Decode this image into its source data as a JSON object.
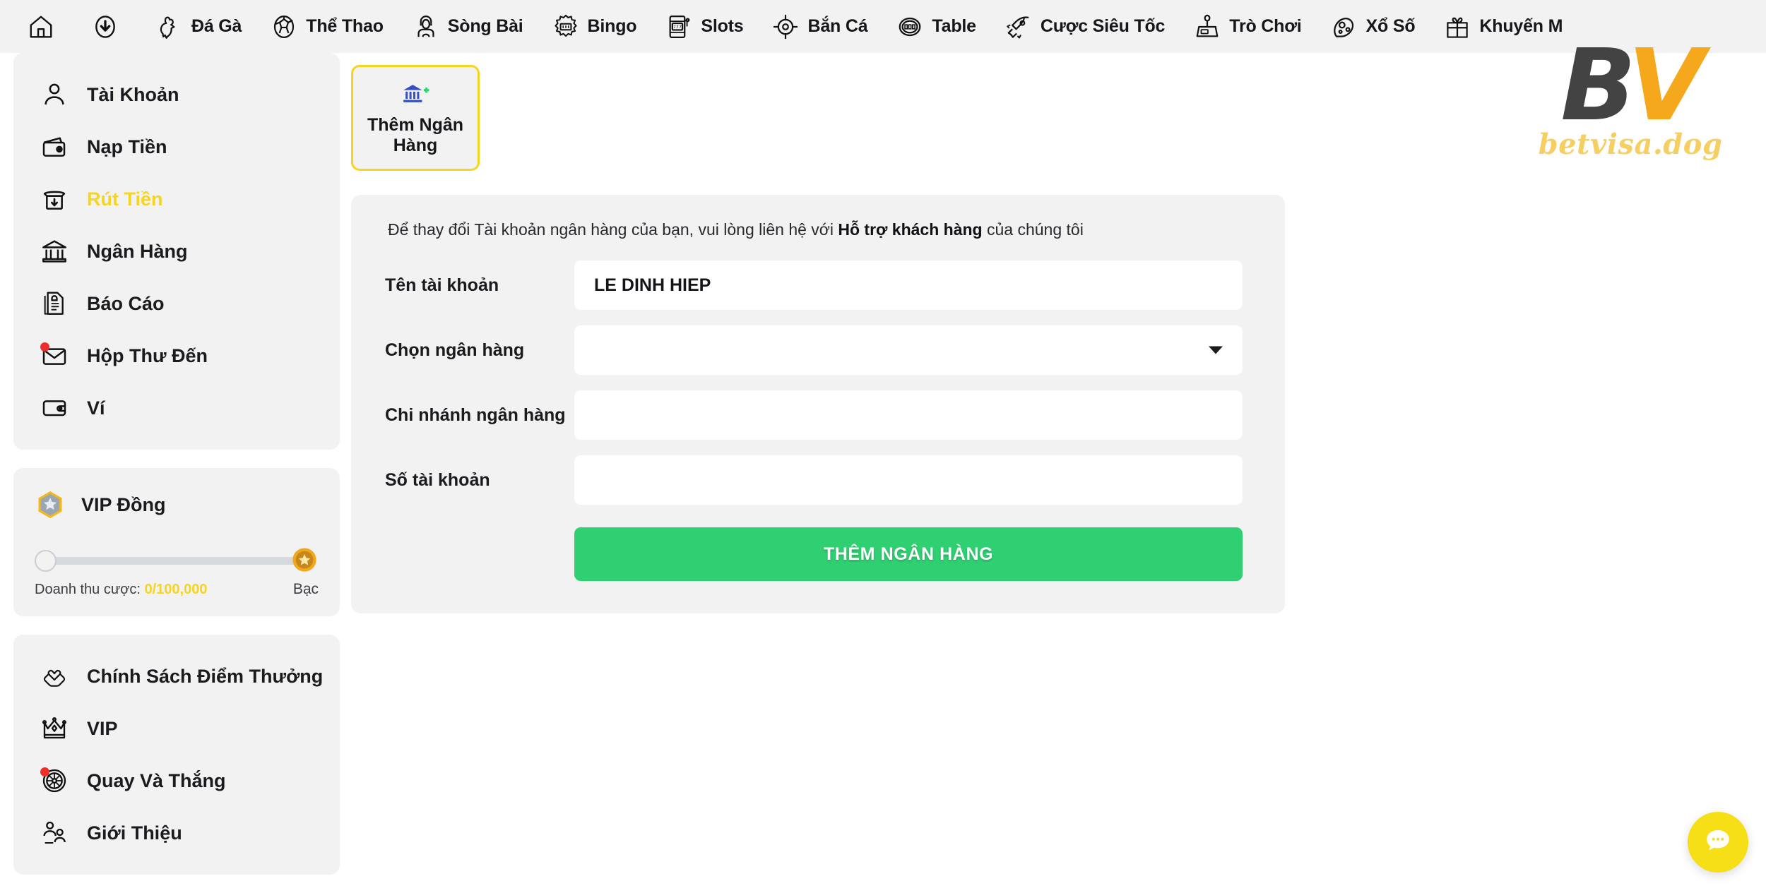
{
  "topnav": {
    "items": [
      {
        "label": "",
        "icon": "home-icon"
      },
      {
        "label": "",
        "icon": "download-icon"
      },
      {
        "label": "Đá Gà",
        "icon": "rooster-icon"
      },
      {
        "label": "Thể Thao",
        "icon": "soccer-ball-icon"
      },
      {
        "label": "Sòng Bài",
        "icon": "casino-dealer-icon"
      },
      {
        "label": "Bingo",
        "icon": "bingo-icon"
      },
      {
        "label": "Slots",
        "icon": "slot-machine-icon"
      },
      {
        "label": "Bắn Cá",
        "icon": "target-icon"
      },
      {
        "label": "Table",
        "icon": "table-games-icon"
      },
      {
        "label": "Cược Siêu Tốc",
        "icon": "rocket-icon"
      },
      {
        "label": "Trò Chơi",
        "icon": "arcade-icon"
      },
      {
        "label": "Xổ Số",
        "icon": "lottery-ball-icon"
      },
      {
        "label": "Khuyến M",
        "icon": "gift-icon"
      }
    ]
  },
  "sidebar": {
    "menu": [
      {
        "label": "Tài Khoản",
        "icon": "user-icon",
        "active": false,
        "badge": false
      },
      {
        "label": "Nạp Tiền",
        "icon": "wallet-deposit-icon",
        "active": false,
        "badge": false
      },
      {
        "label": "Rút Tiền",
        "icon": "withdraw-icon",
        "active": true,
        "badge": false
      },
      {
        "label": "Ngân Hàng",
        "icon": "bank-icon",
        "active": false,
        "badge": false
      },
      {
        "label": "Báo Cáo",
        "icon": "report-icon",
        "active": false,
        "badge": false
      },
      {
        "label": "Hộp Thư Đến",
        "icon": "envelope-icon",
        "active": false,
        "badge": true
      },
      {
        "label": "Ví",
        "icon": "wallet-icon",
        "active": false,
        "badge": false
      }
    ],
    "vip": {
      "title": "VIP Đồng",
      "badge_icon": "vip-hex-star-icon",
      "end_badge_icon": "silver-tier-badge-icon",
      "revenue_label": "Doanh thu cược:",
      "revenue_value": "0/100,000",
      "tier_label": "Bạc",
      "progress_percent": 0
    },
    "promo_menu": [
      {
        "label": "Chính Sách Điểm Thưởng",
        "icon": "hands-heart-icon",
        "badge": false
      },
      {
        "label": "VIP",
        "icon": "crown-icon",
        "badge": false
      },
      {
        "label": "Quay Và Thắng",
        "icon": "spin-wheel-icon",
        "badge": true
      },
      {
        "label": "Giới Thiệu",
        "icon": "referral-icon",
        "badge": false
      }
    ]
  },
  "main": {
    "tabs": [
      {
        "label": "Thêm Ngân Hàng",
        "icon": "bank-plus-icon",
        "selected": true
      }
    ],
    "notice": {
      "prefix": "Để thay đổi Tài khoản ngân hàng của bạn, vui lòng liên hệ với ",
      "emphasis": "Hỗ trợ khách hàng",
      "suffix": " của chúng tôi"
    },
    "form": {
      "fields": [
        {
          "label": "Tên tài khoản",
          "value": "LE DINH HIEP",
          "placeholder": "",
          "type": "text"
        },
        {
          "label": "Chọn ngân hàng",
          "value": "",
          "placeholder": "",
          "type": "select"
        },
        {
          "label": "Chi nhánh ngân hàng",
          "value": "",
          "placeholder": "",
          "type": "text"
        },
        {
          "label": "Số tài khoản",
          "value": "",
          "placeholder": "",
          "type": "text"
        }
      ],
      "submit_label": "THÊM NGÂN HÀNG"
    }
  },
  "logo": {
    "mark_first": "B",
    "mark_second": "V",
    "domain": "betvisa.dog"
  },
  "chat": {
    "icon": "chat-bubble-icon"
  },
  "colors": {
    "accent_yellow": "#f5d520",
    "submit_green": "#2fd072",
    "panel_gray": "#f2f2f2",
    "logo_amber": "#f5a81c",
    "badge_red": "#ee2d2d"
  }
}
